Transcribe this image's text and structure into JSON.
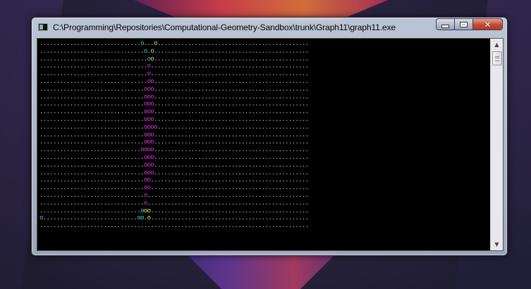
{
  "window": {
    "title": "C:\\Programming\\Repositories\\Computational-Geometry-Sandbox\\trunk\\Graph11\\graph11.exe",
    "icon": "console-app-icon",
    "buttons": {
      "minimize": "minimize",
      "maximize": "maximize",
      "close": "close"
    }
  },
  "console": {
    "background": "#000000",
    "dot_color": "#c0c0c0",
    "colors": {
      "c": "#2fd8e8",
      "y": "#e8e050",
      "m": "#e030e0"
    },
    "rows": [
      "................................................................................",
      "................................................................................",
      "................................................................................",
      "................................................................................",
      "................................................................................",
      "................................................................................",
      "................................................................................",
      "................................................................................",
      "................................................................................",
      "................................................................................",
      "................................................................................",
      "................................................................................",
      "................................................................................",
      "................................................................................",
      "................................................................................",
      "................................................................................",
      "................................................................................",
      "................................................................................",
      "................................................................................",
      "................................................................................",
      "................................................................................",
      "................................................................................",
      "................................................................................",
      "................................................................................",
      "................................................................................"
    ],
    "markers": [
      {
        "row": 0,
        "col": 30,
        "ch": "o",
        "c": "c"
      },
      {
        "row": 0,
        "col": 34,
        "ch": "o",
        "c": "y"
      },
      {
        "row": 1,
        "col": 31,
        "ch": "o",
        "c": "c"
      },
      {
        "row": 1,
        "col": 33,
        "ch": "o",
        "c": "y"
      },
      {
        "row": 2,
        "col": 32,
        "ch": "o",
        "c": "c"
      },
      {
        "row": 2,
        "col": 33,
        "ch": "o",
        "c": "y"
      },
      {
        "row": 3,
        "col": 32,
        "ch": "o",
        "c": "m"
      },
      {
        "row": 4,
        "col": 32,
        "ch": "o",
        "c": "m"
      },
      {
        "row": 5,
        "col": 32,
        "ch": "o",
        "c": "m"
      },
      {
        "row": 5,
        "col": 33,
        "ch": "o",
        "c": "m"
      },
      {
        "row": 6,
        "col": 31,
        "ch": "o",
        "c": "m"
      },
      {
        "row": 6,
        "col": 32,
        "ch": "o",
        "c": "m"
      },
      {
        "row": 6,
        "col": 33,
        "ch": "o",
        "c": "m"
      },
      {
        "row": 7,
        "col": 31,
        "ch": "o",
        "c": "m"
      },
      {
        "row": 7,
        "col": 32,
        "ch": "o",
        "c": "m"
      },
      {
        "row": 7,
        "col": 33,
        "ch": "o",
        "c": "m"
      },
      {
        "row": 8,
        "col": 31,
        "ch": "o",
        "c": "m"
      },
      {
        "row": 8,
        "col": 32,
        "ch": "o",
        "c": "m"
      },
      {
        "row": 8,
        "col": 33,
        "ch": "o",
        "c": "m"
      },
      {
        "row": 9,
        "col": 31,
        "ch": "o",
        "c": "m"
      },
      {
        "row": 9,
        "col": 32,
        "ch": "o",
        "c": "m"
      },
      {
        "row": 9,
        "col": 33,
        "ch": "o",
        "c": "m"
      },
      {
        "row": 10,
        "col": 31,
        "ch": "o",
        "c": "m"
      },
      {
        "row": 10,
        "col": 32,
        "ch": "o",
        "c": "m"
      },
      {
        "row": 10,
        "col": 33,
        "ch": "o",
        "c": "m"
      },
      {
        "row": 11,
        "col": 31,
        "ch": "o",
        "c": "m"
      },
      {
        "row": 11,
        "col": 32,
        "ch": "o",
        "c": "m"
      },
      {
        "row": 11,
        "col": 33,
        "ch": "o",
        "c": "m"
      },
      {
        "row": 11,
        "col": 34,
        "ch": "o",
        "c": "m"
      },
      {
        "row": 12,
        "col": 31,
        "ch": "o",
        "c": "m"
      },
      {
        "row": 12,
        "col": 32,
        "ch": "o",
        "c": "m"
      },
      {
        "row": 12,
        "col": 33,
        "ch": "o",
        "c": "m"
      },
      {
        "row": 13,
        "col": 31,
        "ch": "o",
        "c": "m"
      },
      {
        "row": 13,
        "col": 32,
        "ch": "o",
        "c": "m"
      },
      {
        "row": 13,
        "col": 33,
        "ch": "o",
        "c": "m"
      },
      {
        "row": 14,
        "col": 30,
        "ch": "o",
        "c": "m"
      },
      {
        "row": 14,
        "col": 31,
        "ch": "o",
        "c": "m"
      },
      {
        "row": 14,
        "col": 32,
        "ch": "o",
        "c": "m"
      },
      {
        "row": 14,
        "col": 33,
        "ch": "o",
        "c": "m"
      },
      {
        "row": 15,
        "col": 31,
        "ch": "o",
        "c": "m"
      },
      {
        "row": 15,
        "col": 32,
        "ch": "o",
        "c": "m"
      },
      {
        "row": 15,
        "col": 33,
        "ch": "o",
        "c": "m"
      },
      {
        "row": 16,
        "col": 31,
        "ch": "o",
        "c": "m"
      },
      {
        "row": 16,
        "col": 32,
        "ch": "o",
        "c": "m"
      },
      {
        "row": 16,
        "col": 33,
        "ch": "o",
        "c": "m"
      },
      {
        "row": 17,
        "col": 31,
        "ch": "o",
        "c": "m"
      },
      {
        "row": 17,
        "col": 32,
        "ch": "o",
        "c": "m"
      },
      {
        "row": 17,
        "col": 33,
        "ch": "o",
        "c": "m"
      },
      {
        "row": 18,
        "col": 31,
        "ch": "o",
        "c": "m"
      },
      {
        "row": 18,
        "col": 32,
        "ch": "o",
        "c": "m"
      },
      {
        "row": 19,
        "col": 31,
        "ch": "o",
        "c": "m"
      },
      {
        "row": 19,
        "col": 32,
        "ch": "o",
        "c": "m"
      },
      {
        "row": 20,
        "col": 31,
        "ch": "o",
        "c": "m"
      },
      {
        "row": 21,
        "col": 31,
        "ch": "o",
        "c": "m"
      },
      {
        "row": 22,
        "col": 30,
        "ch": "o",
        "c": "c"
      },
      {
        "row": 22,
        "col": 31,
        "ch": "o",
        "c": "y"
      },
      {
        "row": 22,
        "col": 32,
        "ch": "o",
        "c": "y"
      },
      {
        "row": 23,
        "col": 0,
        "ch": "o",
        "c": "c"
      },
      {
        "row": 23,
        "col": 29,
        "ch": "o",
        "c": "c"
      },
      {
        "row": 23,
        "col": 30,
        "ch": "o",
        "c": "c"
      },
      {
        "row": 23,
        "col": 32,
        "ch": "o",
        "c": "y"
      }
    ]
  },
  "scrollbar": {
    "up": "▲",
    "down": "▼"
  }
}
